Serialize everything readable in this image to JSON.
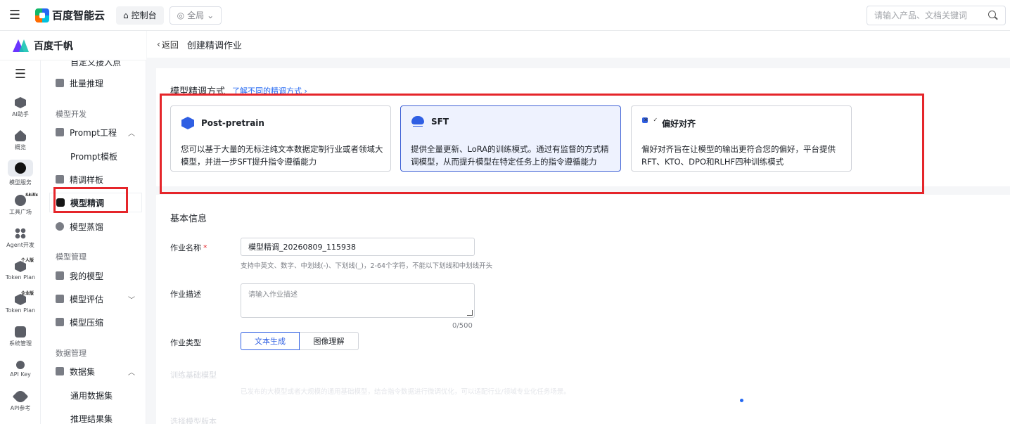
{
  "topbar": {
    "brand": "百度智能云",
    "console": "控制台",
    "region": "全局",
    "search_placeholder": "请输入产品、文档关键词"
  },
  "product": {
    "name": "百度千帆"
  },
  "rail": {
    "items": [
      {
        "label": "AI助手"
      },
      {
        "label": "概览"
      },
      {
        "label": "模型服务"
      },
      {
        "label": "工具广场",
        "badge": "Skills"
      },
      {
        "label": "Agent开发"
      },
      {
        "label": "Token Plan",
        "badge": "个人版"
      },
      {
        "label": "Token Plan",
        "badge": "企业版"
      },
      {
        "label": "系统管理"
      },
      {
        "label": "API Key"
      },
      {
        "label": "API参考"
      }
    ]
  },
  "sidebar": {
    "cut_item": "自定义接入点",
    "batch_infer": "批量推理",
    "group_dev": "模型开发",
    "prompt_eng": "Prompt工程",
    "prompt_tpl": "Prompt模板",
    "finetune_sample": "精调样板",
    "finetune": "模型精调",
    "distill": "模型蒸馏",
    "group_mgmt": "模型管理",
    "my_models": "我的模型",
    "eval": "模型评估",
    "compress": "模型压缩",
    "group_data": "数据管理",
    "datasets": "数据集",
    "general_datasets": "通用数据集",
    "infer_results": "推理结果集"
  },
  "header": {
    "back": "返回",
    "title": "创建精调作业"
  },
  "method": {
    "title": "模型精调方式",
    "learn_more": "了解不同的精调方式",
    "cards": [
      {
        "title": "Post-pretrain",
        "desc": "您可以基于大量的无标注纯文本数据定制行业或者领域大模型，并进一步SFT提升指令遵循能力"
      },
      {
        "title": "SFT",
        "desc": "提供全量更新、LoRA的训练模式。通过有监督的方式精调模型，从而提升模型在特定任务上的指令遵循能力"
      },
      {
        "title": "偏好对齐",
        "desc": "偏好对齐旨在让模型的输出更符合您的偏好，平台提供RFT、KTO、DPO和RLHF四种训练模式"
      }
    ]
  },
  "basic": {
    "title": "基本信息",
    "name_label": "作业名称",
    "name_value": "模型精调_20260809_115938",
    "name_hint": "支持中英文、数字、中划线(-)、下划线(_)，2-64个字符，不能以下划线和中划线开头",
    "desc_label": "作业描述",
    "desc_placeholder": "请输入作业描述",
    "desc_counter": "0/500",
    "type_label": "作业类型",
    "type_options": [
      "文本生成",
      "图像理解"
    ],
    "faded_label1": "训练基础模型",
    "faded_hint1": "已发布的大模型或者大规模的通用基础模型，结合指令数据进行微调优化，可以适配行业/领域专业化任务场景。",
    "faded_label2": "选择模型版本"
  },
  "colors": {
    "accent": "#2f5fe3",
    "highlight": "#e5252a"
  }
}
